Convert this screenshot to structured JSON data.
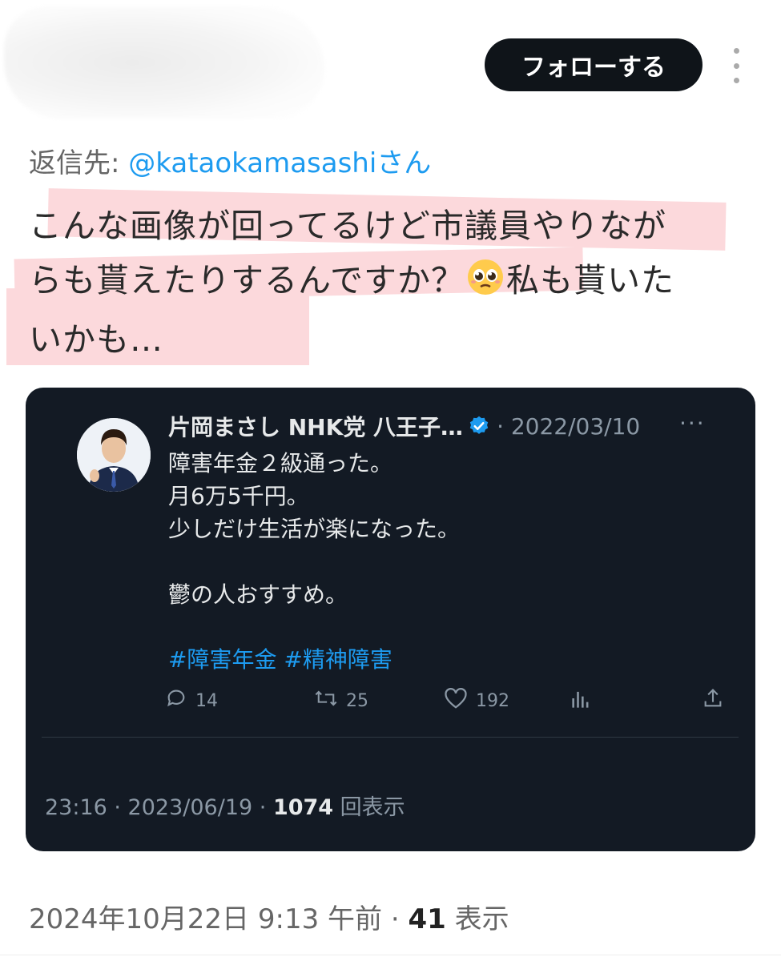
{
  "header": {
    "follow_label": "フォローする",
    "more_icon": "more-vertical-icon"
  },
  "reply": {
    "prefix": "返信先: ",
    "handle": "@kataokamasashi",
    "suffix": "さん"
  },
  "tweet": {
    "line1": "こんな画像が回ってるけど市議員やりなが",
    "line2a": "らも貰えたりするんですか？",
    "emoji": "pleading-face",
    "line2b": "私も貰いた",
    "line3": "いかも…"
  },
  "embedded": {
    "name": "片岡まさし NHK党 八王子…",
    "date": "· 2022/03/10",
    "more": "···",
    "body": [
      "障害年金２級通った。",
      "月6万5千円。",
      "少しだけ生活が楽になった。",
      "",
      "鬱の人おすすめ。"
    ],
    "hashtags": "#障害年金 #精神障害",
    "stats": {
      "replies": "14",
      "retweets": "25",
      "likes": "192"
    },
    "footer_time": "23:16 · 2023/06/19 · ",
    "footer_views": "1074",
    "footer_views_label": " 回表示",
    "colors": {
      "background": "#131a24",
      "link": "#1d9bf0",
      "muted": "#8b98a5"
    }
  },
  "footer": {
    "timestamp": "2024年10月22日 9:13 午前 · ",
    "views": "41",
    "views_label": " 表示"
  },
  "colors": {
    "follow_button": "#0f1419",
    "highlight": "#fcd9dc",
    "link": "#1d9bf0"
  }
}
